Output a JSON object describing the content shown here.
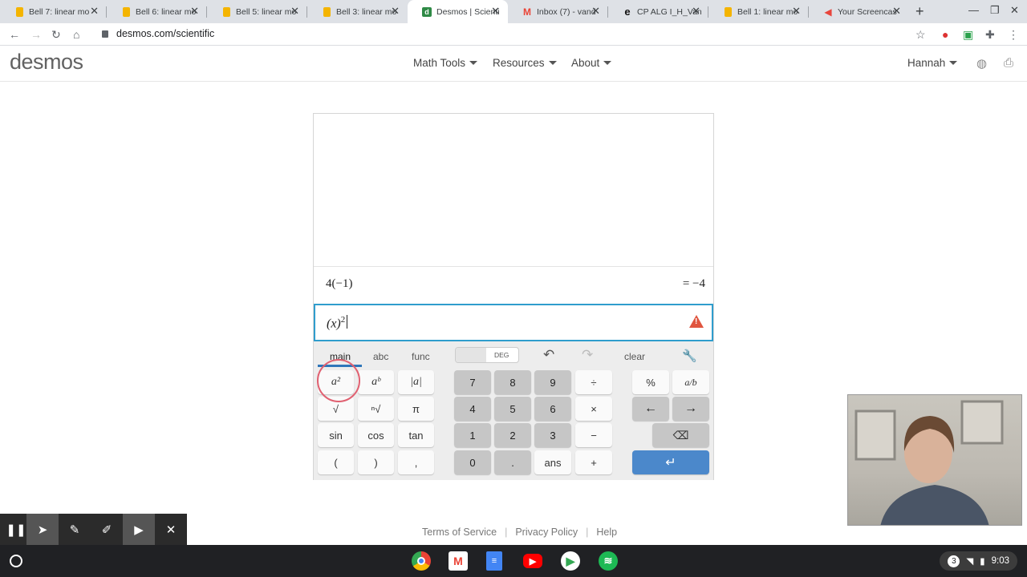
{
  "browser": {
    "tabs": [
      {
        "title": "Bell 7: linear mo",
        "icon": "google-docs-icon"
      },
      {
        "title": "Bell 6: linear mo",
        "icon": "google-docs-icon"
      },
      {
        "title": "Bell 5: linear mo",
        "icon": "google-docs-icon"
      },
      {
        "title": "Bell 3: linear mo",
        "icon": "google-docs-icon"
      },
      {
        "title": "Desmos | Scienti",
        "icon": "desmos-icon",
        "active": true
      },
      {
        "title": "Inbox (7) - vand",
        "icon": "gmail-icon"
      },
      {
        "title": "CP ALG I_H_Van",
        "icon": "edpuzzle-icon"
      },
      {
        "title": "Bell 1: linear mo",
        "icon": "google-docs-icon"
      },
      {
        "title": "Your Screencas",
        "icon": "screencastify-icon"
      }
    ],
    "url": "desmos.com/scientific"
  },
  "header": {
    "logo": "desmos",
    "menus": [
      "Math Tools",
      "Resources",
      "About"
    ],
    "user": "Hannah"
  },
  "calculator": {
    "history_expr": "4(−1)",
    "history_result": "= −4",
    "input_expr": "(x)",
    "input_exponent": "2",
    "tabs": [
      "main",
      "abc",
      "func"
    ],
    "angle_mode": "DEG",
    "clear_label": "clear",
    "keys": {
      "left": [
        [
          "a²",
          "aᵇ",
          "|a|"
        ],
        [
          "√",
          "ⁿ√",
          "π"
        ],
        [
          "sin",
          "cos",
          "tan"
        ],
        [
          "(",
          ")",
          ","
        ]
      ],
      "numbers": [
        [
          "7",
          "8",
          "9",
          "÷"
        ],
        [
          "4",
          "5",
          "6",
          "×"
        ],
        [
          "1",
          "2",
          "3",
          "−"
        ],
        [
          "0",
          ".",
          "ans",
          "+"
        ]
      ],
      "right": [
        [
          "%",
          "a/b"
        ],
        [
          "←",
          "→"
        ]
      ]
    }
  },
  "footer": {
    "links": [
      "Terms of Service",
      "Privacy Policy",
      "Help"
    ]
  },
  "shelf": {
    "badge": "3",
    "time": "9:03"
  }
}
